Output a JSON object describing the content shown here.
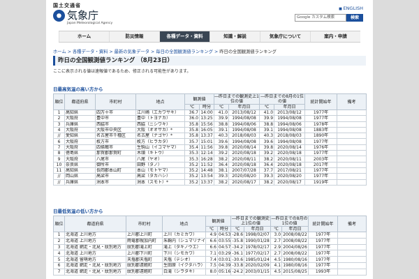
{
  "header": {
    "ministry": "国土交通省",
    "logo_text": "気象庁",
    "logo_sub": "Japan Meteorological Agency",
    "english_link": "ENGLISH",
    "search_placeholder": "Google カスタム検索",
    "search_button": "検索"
  },
  "nav": [
    "ホーム",
    "防災情報",
    "各種データ・資料",
    "知識・解説",
    "気象庁について",
    "案内・申請"
  ],
  "breadcrumb": {
    "items": [
      "ホーム",
      "各種データ・資料",
      "最新の気象データ",
      "毎日の全国観測値ランキング"
    ],
    "current": "昨日の全国観測値ランキング",
    "sep": " > "
  },
  "title": "昨日の全国観測値ランキング （8月23日）",
  "note": "ここに表示される値は速報値であるため、修正される可能性があります。",
  "high": {
    "section_title": "日最高気温の高い方から",
    "headers": {
      "rank": "順位",
      "pref": "都道府県",
      "city": "市町村",
      "point": "地点",
      "obs": "観測値",
      "celsius": "℃",
      "time": "時分",
      "hist_all": "―昨日までの観測史上1位の値",
      "hist_month": "―昨日までの8月の1位の値",
      "ymd": "年月日",
      "start": "統計開始年",
      "remark": "備考"
    },
    "rows": [
      [
        "1",
        "高知県",
        "四万十市",
        "江川崎（エカワサキ）",
        "36.7",
        "14:00",
        "41.0",
        "2013/08/12",
        "41.0",
        "2013/08/12",
        "1977年"
      ],
      [
        "2",
        "大阪府",
        "豊中市",
        "豊中（トヨナカ）",
        "36.0",
        "13:25",
        "39.9",
        "1994/08/08",
        "39.9",
        "1994/08/08",
        "1977年"
      ],
      [
        "3",
        "兵庫県",
        "西脇市",
        "西脇（ニシワキ）",
        "35.8",
        "15:56",
        "38.8",
        "1994/08/06",
        "38.8",
        "1994/08/06",
        "1978年"
      ],
      [
        "4",
        "大阪府",
        "大阪市中央区",
        "大阪（オオサカ）*",
        "35.8",
        "16:05",
        "39.1",
        "1994/08/08",
        "39.1",
        "1994/08/08",
        "1883年"
      ],
      [
        "//",
        "愛知県",
        "名古屋市千種区",
        "名古屋（ナゴヤ）*",
        "35.8",
        "13:37",
        "40.3",
        "2018/08/03",
        "40.3",
        "2018/08/03",
        "1890年"
      ],
      [
        "6",
        "大阪府",
        "枚方市",
        "枚方（ヒラカタ）",
        "35.7",
        "15:01",
        "39.6",
        "1994/08/08",
        "39.6",
        "1994/08/08",
        "1977年"
      ],
      [
        "7",
        "大阪府",
        "四條畷市",
        "生駒山（イコマヤマ）",
        "35.4",
        "11:56",
        "39.8",
        "2020/08/14",
        "39.8",
        "2020/08/14",
        "1976年"
      ],
      [
        "8",
        "徳島県",
        "那賀郡那賀町",
        "木頭（キトウ）",
        "35.3",
        "12:14",
        "39.2",
        "2020/08/18",
        "39.2",
        "2020/08/18",
        "1977年"
      ],
      [
        "9",
        "大阪府",
        "八尾市",
        "八尾（ヤオ）",
        "35.3",
        "16:28",
        "38.2",
        "2020/08/11",
        "38.2",
        "2020/08/11",
        "2003年"
      ],
      [
        "10",
        "奈良県",
        "御所市",
        "田野（タノ）",
        "35.2",
        "11:52",
        "36.4",
        "2020/08/18",
        "36.4",
        "2020/08/18",
        "2017年"
      ],
      [
        "11",
        "高知県",
        "長岡郡本山町",
        "本山（モトヤマ）",
        "35.2",
        "14:48",
        "38.1",
        "2007/07/28",
        "37.7",
        "2017/08/21",
        "1977年"
      ],
      [
        "//",
        "岡山県",
        "高梁市",
        "高梁（タカハシ）",
        "35.2",
        "13:54",
        "39.3",
        "2020/08/20",
        "39.3",
        "2020/08/20",
        "1977年"
      ],
      [
        "//",
        "兵庫県",
        "洲本市",
        "洲本（スモト）*",
        "35.2",
        "13:37",
        "38.2",
        "2020/08/17",
        "38.2",
        "2020/08/17",
        "1919年"
      ]
    ]
  },
  "low": {
    "section_title": "日最低気温の低い方から",
    "headers": {
      "rank": "順位",
      "pref": "都道府県",
      "city": "市町村",
      "point": "地点",
      "obs": "観測値",
      "celsius": "℃",
      "time": "時分",
      "hist_all": "―昨日までの観測史上1位の値",
      "hist_month": "―昨日までの8月の1位の値",
      "ymd": "年月日",
      "start": "統計開始年",
      "remark": "備考"
    },
    "rows": [
      [
        "1",
        "北海道 上川地方",
        "上川郡上川町",
        "上川（カミカワ）",
        "4.9",
        "04:53",
        "-28.6",
        "1998/02/07",
        "3.0",
        "2008/08/22",
        "1977年"
      ],
      [
        "2",
        "北海道 上川地方",
        "雨竜郡幌加内町",
        "朱鞠内（シュマリナイ）",
        "6.6",
        "03:55",
        "-35.8",
        "1990/01/28",
        "2.7",
        "2008/08/22",
        "1977年"
      ],
      [
        "3",
        "北海道 網走・北見・紋別地方",
        "紋別郡滝上町",
        "滝上（タキノウエ）",
        "6.6",
        "04:57",
        "-34.2",
        "1978/02/17",
        "2.9",
        "2004/08/26",
        "1977年"
      ],
      [
        "4",
        "北海道 上川地方",
        "上川郡下川町",
        "下川（シモカワ）",
        "7.1",
        "03:29",
        "-36.1",
        "1977/02/17",
        "2.7",
        "2008/08/22",
        "1977年"
      ],
      [
        "5",
        "北海道 留萌地方",
        "天塩郡天塩町",
        "天塩（テシオ）",
        "7.4",
        "03:01",
        "-30.6",
        "1985/01/24",
        "4.5",
        "1980/08/16",
        "1977年"
      ],
      [
        "6",
        "北海道 網走・北見・紋別地方",
        "紋別郡遠軽町",
        "生田原（イクタハラ）",
        "7.5",
        "04:39",
        "-33.8",
        "2020/02/09",
        "4.1",
        "1980/08/16",
        "1977年"
      ],
      [
        "7",
        "北海道 網走・北見・紋別地方",
        "紋別郡遠軽町",
        "白滝（シラタキ）",
        "8.0",
        "05:16",
        "-24.2",
        "2003/01/15",
        "4.5",
        "2015/08/25",
        "1993年"
      ]
    ]
  }
}
